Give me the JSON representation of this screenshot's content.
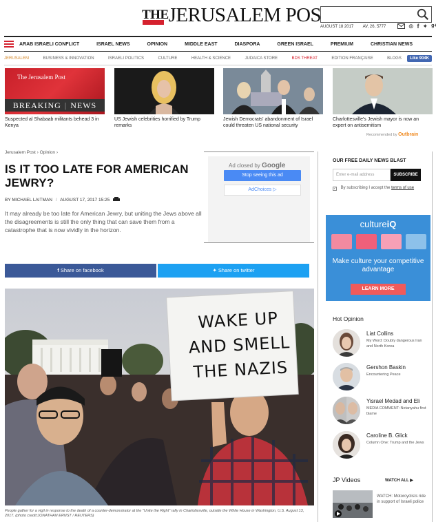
{
  "header": {
    "logo_the": "THE",
    "logo_rest": "JERUSALEM POST",
    "date": "AUGUST 18 2017",
    "hebrew_date": "AV, 26, 5777",
    "search_placeholder": ""
  },
  "nav_primary": [
    "ARAB ISRAELI CONFLICT",
    "ISRAEL NEWS",
    "OPINION",
    "MIDDLE EAST",
    "DIASPORA",
    "GREEN ISRAEL",
    "PREMIUM",
    "CHRISTIAN NEWS"
  ],
  "nav_secondary": [
    "JERUSALEM",
    "BUSINESS & INNOVATION",
    "ISRAELI POLITICS",
    "CULTURE",
    "HEALTH & SCIENCE",
    "JUDAICA STORE",
    "BDS THREAT",
    "EDITION FRANÇAISE",
    "BLOGS"
  ],
  "fb_like": "Like 904K",
  "top_stories": [
    {
      "caption": "Suspected al Shabaab militants behead 3 in Kenya",
      "thumb_text_brand": "The Jerusalem Post",
      "thumb_text_left": "BREAKING",
      "thumb_text_right": "NEWS"
    },
    {
      "caption": "US Jewish celebrities horrified by Trump remarks"
    },
    {
      "caption": "Jewish Democrats' abandonment of Israel could threaten US national security"
    },
    {
      "caption": "Charlottesville's Jewish mayor is now an expert on antisemitism"
    }
  ],
  "recommended": {
    "label": "Recommended by",
    "brand": "Outbrain"
  },
  "breadcrumb": [
    "Jerusalem Post",
    "Opinion"
  ],
  "article": {
    "title": "IS IT TOO LATE FOR AMERICAN JEWRY?",
    "author": "BY MICHAEL LAITMAN",
    "date": "AUGUST 17, 2017 15:25",
    "lede": "It may already be too late for American Jewry, but uniting the Jews above all the disagreements is still the only thing that can save them from a catastrophe that is now vividly in the horizon.",
    "image_caption": "People gather for a vigil in response to the death of a counter-demonstrator at the \"Unite the Right\" rally in Charlottesville, outside the White House in Washington, U.S. August 13, 2017. (photo credit:JONATHAN ERNST / REUTERS)",
    "sign_line1": "WAKE UP",
    "sign_line2": "AND SMELL",
    "sign_line3": "THE NAZIS"
  },
  "ad": {
    "closed_by": "Ad closed by",
    "google": "Google",
    "stop": "Stop seeing this ad",
    "adchoices": "AdChoices"
  },
  "share": {
    "facebook": "Share on facebook",
    "twitter": "Share on twitter"
  },
  "sidebar": {
    "newsletter_title": "OUR FREE DAILY NEWS BLAST",
    "email_placeholder": "Enter e-mail address",
    "subscribe": "SUBSCRIBE",
    "terms_prefix": "By subscribing I accept the",
    "terms_link": "terms of use",
    "culture_ad": {
      "logo_a": "culture",
      "logo_b": "iQ",
      "headline": "Make culture your competitive advantage",
      "button": "LEARN MORE"
    },
    "hot_opinion_title": "Hot Opinion",
    "hot_opinion": [
      {
        "name": "Liat Collins",
        "sub": "My Word: Doubly dangerous Iran and North Korea"
      },
      {
        "name": "Gershon Baskin",
        "sub": "Encountering Peace"
      },
      {
        "name": "Yisrael Medad and Eli",
        "sub": "MEDIA COMMENT: Netanyahu first blame"
      },
      {
        "name": "Caroline B. Glick",
        "sub": "Column One: Trump and the Jews"
      }
    ],
    "jp_videos_title": "JP Videos",
    "watch_all": "WATCH ALL",
    "video_caption": "WATCH: Motorcyclists ride in support of Israeli police"
  },
  "colors": {
    "brand_red": "#d5212e",
    "facebook": "#3b5998",
    "twitter": "#1da1f2",
    "culture_bg": "#3a8fd8"
  }
}
